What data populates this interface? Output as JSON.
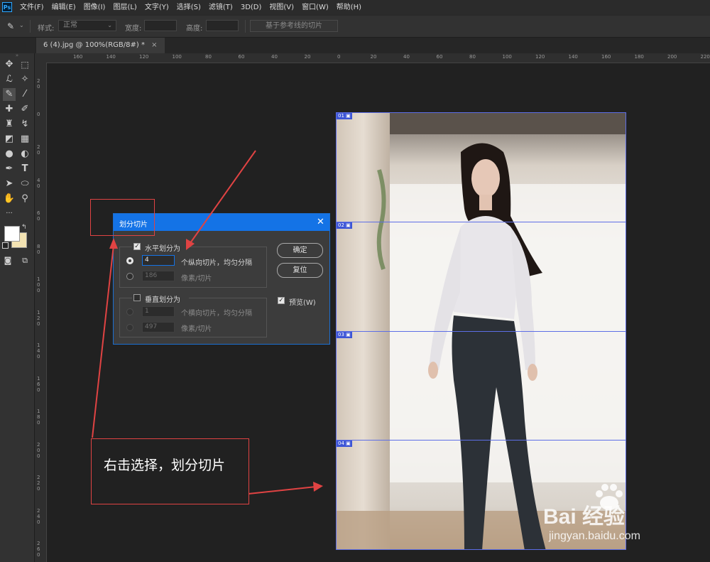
{
  "app": {
    "logo_text": "Ps"
  },
  "menu": [
    "文件(F)",
    "编辑(E)",
    "图像(I)",
    "图层(L)",
    "文字(Y)",
    "选择(S)",
    "滤镜(T)",
    "3D(D)",
    "视图(V)",
    "窗口(W)",
    "帮助(H)"
  ],
  "options_bar": {
    "style_label": "样式:",
    "style_value": "正常",
    "width_label": "宽度:",
    "height_label": "高度:",
    "guides_button": "基于参考线的切片"
  },
  "document_tab": {
    "title": "6 (4).jpg @ 100%(RGB/8#) *",
    "close": "×"
  },
  "ruler_top_labels": [
    "160",
    "140",
    "120",
    "100",
    "80",
    "60",
    "40",
    "20",
    "0",
    "20",
    "40",
    "60",
    "80",
    "100",
    "120",
    "140",
    "160",
    "180",
    "200",
    "220"
  ],
  "ruler_left_labels": [
    "2 0",
    "0",
    "2 0",
    "4 0",
    "6 0",
    "8 0",
    "1 0 0",
    "1 2 0",
    "1 4 0",
    "1 6 0",
    "1 8 0",
    "2 0 0",
    "2 2 0",
    "2 4 0",
    "2 6 0"
  ],
  "slices": [
    "01",
    "02",
    "03",
    "04"
  ],
  "dialog": {
    "title": "划分切片",
    "close": "✕",
    "horizontal": {
      "checkbox_label": "水平划分为",
      "count_value": "4",
      "count_suffix": "个纵向切片，均匀分隔",
      "pixels_value": "186",
      "pixels_suffix": "像素/切片"
    },
    "vertical": {
      "checkbox_label": "垂直划分为",
      "count_value": "1",
      "count_suffix": "个横向切片，均匀分隔",
      "pixels_value": "497",
      "pixels_suffix": "像素/切片"
    },
    "ok_button": "确定",
    "reset_button": "复位",
    "preview_label": "预览(W)"
  },
  "annotation": {
    "text": "右击选择，划分切片"
  },
  "watermark": {
    "brand": "Bai 经验",
    "url": "jingyan.baidu.com"
  },
  "colors": {
    "accent": "#1473e6",
    "slice_line": "#5d6ee6",
    "annotation_red": "#e04343"
  }
}
